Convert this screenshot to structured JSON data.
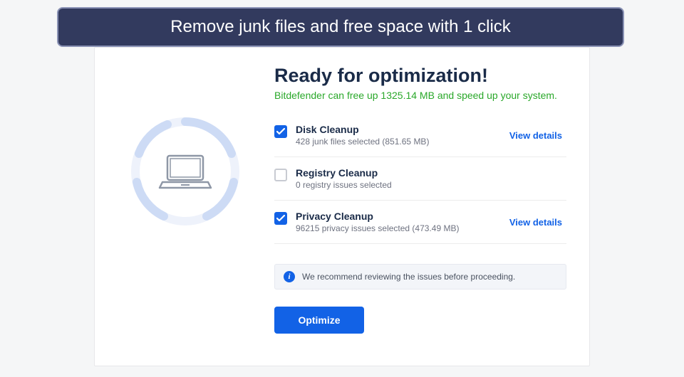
{
  "banner": {
    "text": "Remove junk files and free space with 1 click"
  },
  "heading": "Ready for optimization!",
  "subheading": "Bitdefender can free up 1325.14 MB and speed up your system.",
  "items": [
    {
      "title": "Disk Cleanup",
      "subtitle": "428 junk files selected (851.65 MB)",
      "checked": true,
      "view_label": "View details"
    },
    {
      "title": "Registry Cleanup",
      "subtitle": "0 registry issues selected",
      "checked": false
    },
    {
      "title": "Privacy Cleanup",
      "subtitle": "96215 privacy issues selected (473.49 MB)",
      "checked": true,
      "view_label": "View details"
    }
  ],
  "notice": "We recommend reviewing the issues before proceeding.",
  "optimize_label": "Optimize",
  "colors": {
    "accent": "#1262e6",
    "success": "#2aa82a",
    "banner_bg": "#323a5e"
  }
}
